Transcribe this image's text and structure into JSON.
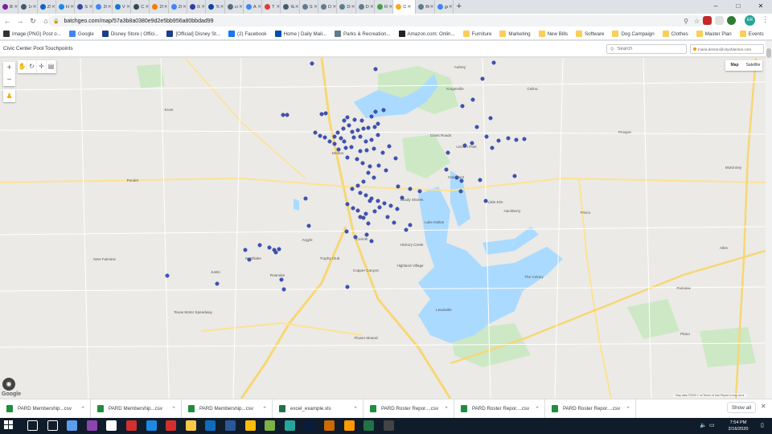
{
  "browser": {
    "tabs": [
      {
        "label": "8B_E",
        "color": "#7b1fa2"
      },
      {
        "label": "14C_",
        "color": "#455a64"
      },
      {
        "label": "ZIP L",
        "color": "#1565c0"
      },
      {
        "label": "Hom",
        "color": "#1e88e5"
      },
      {
        "label": "Strat",
        "color": "#3949ab"
      },
      {
        "label": "2019",
        "color": "#4285f4"
      },
      {
        "label": "VTB",
        "color": "#1976d2"
      },
      {
        "label": "Choo",
        "color": "#37474f"
      },
      {
        "label": "25 Tr",
        "color": "#f57c00"
      },
      {
        "label": "2020",
        "color": "#4285f4"
      },
      {
        "label": "08-A",
        "color": "#303f9f"
      },
      {
        "label": "Touri",
        "color": "#0d47a1"
      },
      {
        "label": "creat",
        "color": "#546e7a"
      },
      {
        "label": "Aquir",
        "color": "#4285f4"
      },
      {
        "label": "The L",
        "color": "#e53935"
      },
      {
        "label": "What",
        "color": "#455a64"
      },
      {
        "label": "Store",
        "color": "#607d8b"
      },
      {
        "label": "Dent",
        "color": "#607d8b"
      },
      {
        "label": "Dent",
        "color": "#607d8b"
      },
      {
        "label": "Dent",
        "color": "#607d8b"
      },
      {
        "label": "Rec1",
        "color": "#43a047"
      },
      {
        "label": "C",
        "color": "#f9a825",
        "active": true
      },
      {
        "label": "BC_B",
        "color": "#607d8b"
      },
      {
        "label": "gold",
        "color": "#4285f4"
      }
    ],
    "new_tab": "+",
    "window_controls": [
      "–",
      "□",
      "✕"
    ],
    "url": "batchgeo.com/map/57a3b8a0380e9d2e5bb956a80bbdad99",
    "back": "←",
    "forward": "→",
    "reload": "↻",
    "home": "⌂",
    "lock": "🔒",
    "zoom_icon": "⚲",
    "star_icon": "☆",
    "profile_initials": "ER",
    "menu_icon": "⋮",
    "bookmarks": [
      {
        "label": "Image (PNG) Post o...",
        "icon": "image-bookmark-icon",
        "color": "#333333"
      },
      {
        "label": "Google",
        "icon": "google-icon",
        "color": "#4285f4"
      },
      {
        "label": "Disney Store | Offici...",
        "icon": "disney-icon",
        "color": "#1a3e8c"
      },
      {
        "label": "[Official] Disney St...",
        "icon": "disney-icon",
        "color": "#1a3e8c"
      },
      {
        "label": "(2) Facebook",
        "icon": "facebook-icon",
        "color": "#1877f2"
      },
      {
        "label": "Home | Daily Mail...",
        "icon": "daily-mail-icon",
        "color": "#004db3"
      },
      {
        "label": "Parks & Recreation...",
        "icon": "parks-icon",
        "color": "#607d8b"
      },
      {
        "label": "Amazon.com: Onlin...",
        "icon": "amazon-icon",
        "color": "#222222"
      },
      {
        "label": "Furniture",
        "icon": "folder-icon",
        "color": "#f9cf5a"
      },
      {
        "label": "Marketing",
        "icon": "folder-icon",
        "color": "#f9cf5a"
      },
      {
        "label": "New Bills",
        "icon": "folder-icon",
        "color": "#f9cf5a"
      },
      {
        "label": "Software",
        "icon": "folder-icon",
        "color": "#f9cf5a"
      },
      {
        "label": "Dog Campaign",
        "icon": "folder-icon",
        "color": "#f9cf5a"
      },
      {
        "label": "Clothes",
        "icon": "folder-icon",
        "color": "#f9cf5a"
      },
      {
        "label": "Master Plan",
        "icon": "folder-icon",
        "color": "#f9cf5a"
      },
      {
        "label": "Events",
        "icon": "folder-icon",
        "color": "#f9cf5a"
      }
    ]
  },
  "page": {
    "title": "Civic Center Pool Touchpoints",
    "search_placeholder": "Search",
    "user_email": "maria.denton@cityofdenton.com"
  },
  "map": {
    "zoom_in": "+",
    "zoom_out": "−",
    "map_type_options": [
      "Map",
      "Satellite"
    ],
    "selected_map_type": "Map",
    "google_logo": "Google",
    "footer": "Map data ©2020  1 mi  Terms of Use  Report a map error",
    "marker_color": "#3f51b5",
    "water_color": "#aadaff",
    "park_color": "#c8e6c0",
    "labels": [
      "Sanger",
      "Ray Roberts Lake",
      "Ray Roberts Lake State Park",
      "Aubrey",
      "Krugerville",
      "Denton",
      "Cross Roads",
      "Lincoln Park",
      "Prosper",
      "Oak Point",
      "Little Elm",
      "Hackberry",
      "Frisco",
      "Corinth",
      "Shady Shores",
      "Lake Dallas",
      "Hickory Creek",
      "Lewisville",
      "Argyle",
      "Northlake",
      "Justin",
      "Roanoke",
      "Trophy Club",
      "Plano",
      "McKinney",
      "Texas Motor Speedway",
      "Copper Canyon",
      "Flower Mound",
      "Highland Village",
      "The Colony",
      "New Fairview",
      "Ponder",
      "Krum",
      "Celina",
      "Allen",
      "Fairview"
    ]
  },
  "downloads": [
    {
      "name": "PARD Membership...csv",
      "type": "csv"
    },
    {
      "name": "PARD Membership...csv",
      "type": "csv"
    },
    {
      "name": "PARD Membership...csv",
      "type": "csv"
    },
    {
      "name": "excel_example.xls",
      "type": "xls"
    },
    {
      "name": "PARD Roster Repor....csv",
      "type": "csv"
    },
    {
      "name": "PARD Roster Repor....csv",
      "type": "csv"
    },
    {
      "name": "PARD Roster Repor....csv",
      "type": "csv"
    }
  ],
  "downloads_show_all": "Show all",
  "downloads_close": "✕",
  "taskbar": {
    "time": "7:54 PM",
    "date": "2/16/2020",
    "apps": [
      {
        "name": "search-icon",
        "color": "#ffffff"
      },
      {
        "name": "task-view-icon",
        "color": "#ffffff"
      },
      {
        "name": "edge-legacy-icon",
        "color": "#5c9ded"
      },
      {
        "name": "media-icon",
        "color": "#8e44ad"
      },
      {
        "name": "store-icon",
        "color": "#ffffff"
      },
      {
        "name": "mail-icon",
        "color": "#d32f2f"
      },
      {
        "name": "edge-icon",
        "color": "#1e88e5"
      },
      {
        "name": "acrobat-icon",
        "color": "#d32f2f"
      },
      {
        "name": "file-explorer-icon",
        "color": "#f9c846"
      },
      {
        "name": "outlook-icon",
        "color": "#0f6cbd"
      },
      {
        "name": "word-icon",
        "color": "#2b579a"
      },
      {
        "name": "chrome-icon",
        "color": "#fbbc05"
      },
      {
        "name": "green-app-icon",
        "color": "#7cb342"
      },
      {
        "name": "feather-app-icon",
        "color": "#26a69a"
      },
      {
        "name": "photoshop-icon",
        "color": "#0a1c3c"
      },
      {
        "name": "bridge-icon",
        "color": "#cc6a00"
      },
      {
        "name": "illustrator-icon",
        "color": "#ff9a00"
      },
      {
        "name": "excel-icon",
        "color": "#217346"
      },
      {
        "name": "calculator-icon",
        "color": "#444444"
      }
    ]
  }
}
